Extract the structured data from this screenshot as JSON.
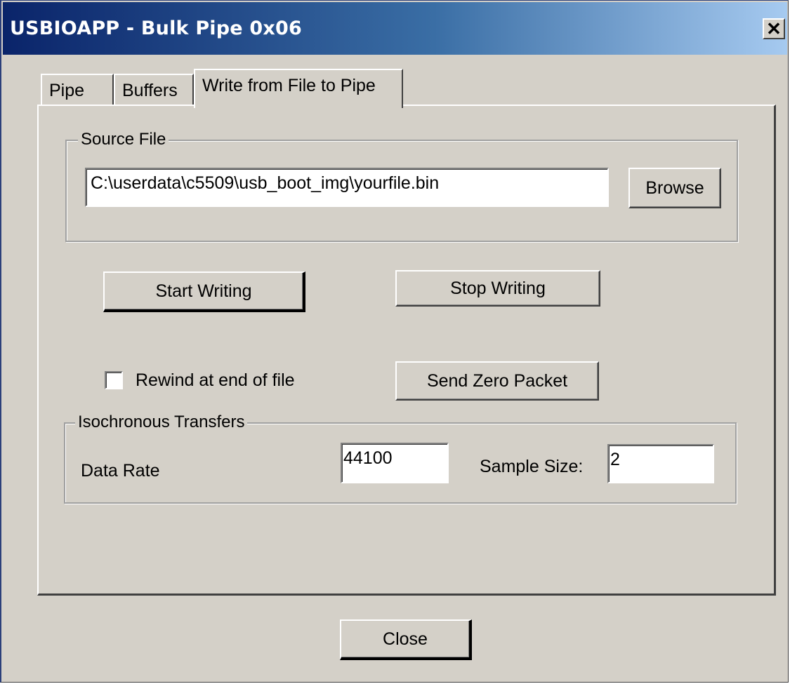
{
  "window": {
    "title": "USBIOAPP - Bulk Pipe 0x06",
    "close_glyph": "✕"
  },
  "tabs": [
    {
      "label": "Pipe",
      "active": false
    },
    {
      "label": "Buffers",
      "active": false
    },
    {
      "label": "Write from File to Pipe",
      "active": true
    }
  ],
  "source_file": {
    "group_label": "Source File",
    "path_value": "C:\\userdata\\c5509\\usb_boot_img\\yourfile.bin",
    "browse_label": "Browse"
  },
  "actions": {
    "start_label": "Start Writing",
    "stop_label": "Stop Writing",
    "send_zero_label": "Send Zero Packet"
  },
  "rewind": {
    "label": "Rewind at end of file",
    "checked": false
  },
  "isochronous": {
    "group_label": "Isochronous Transfers",
    "data_rate_label": "Data Rate",
    "data_rate_value": "44100",
    "sample_size_label": "Sample Size:",
    "sample_size_value": "2"
  },
  "footer": {
    "close_label": "Close"
  },
  "colors": {
    "face": "#d4d0c8",
    "title_start": "#0a246a",
    "title_end": "#a6caf0"
  }
}
